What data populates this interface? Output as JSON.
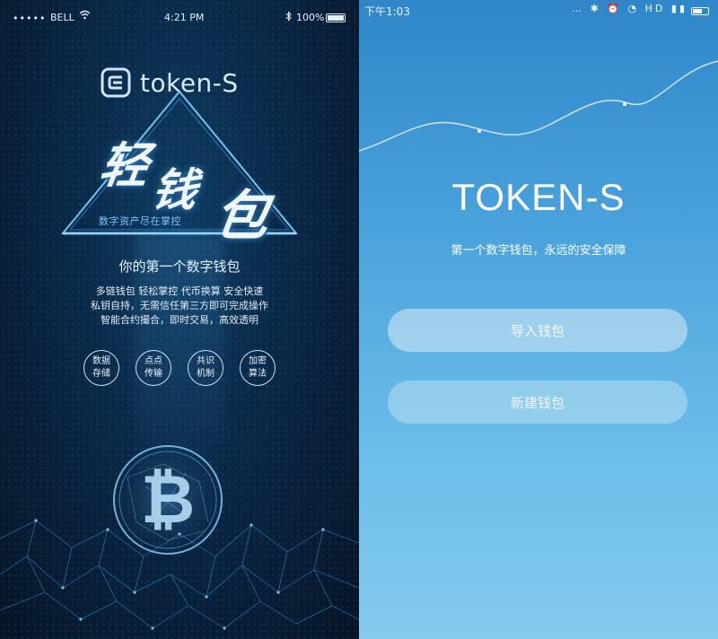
{
  "left_screen": {
    "status_bar": {
      "signal": "•••••",
      "carrier": "BELL",
      "wifi_icon": "wifi-icon",
      "time": "4:21 PM",
      "bluetooth_icon": "bluetooth-icon",
      "battery_percent": "100%"
    },
    "logo_text": "token-S",
    "headline_chars": [
      "轻",
      "钱",
      "包"
    ],
    "slogan": "数字资产尽在掌控",
    "subtitle": "你的第一个数字钱包",
    "description_lines": [
      "多链钱包  轻松掌控  代币换算  安全快速",
      "私钥自持，无需信任第三方即可完成操作",
      "智能合约撮合，即时交易，高效透明"
    ],
    "features": [
      {
        "label": "数据存储"
      },
      {
        "label": "点点传输"
      },
      {
        "label": "共识机制"
      },
      {
        "label": "加密算法"
      }
    ],
    "colors": {
      "accent": "#5ab4ff",
      "background": "#0a2745"
    }
  },
  "right_screen": {
    "status_bar": {
      "time": "下午1:03",
      "icons": "… ✱ ⏰ ◔ HD ▮▮"
    },
    "title": "TOKEN-S",
    "subtitle": "第一个数字钱包，永远的安全保障",
    "buttons": {
      "import_label": "导入钱包",
      "create_label": "新建钱包"
    },
    "colors": {
      "gradient_top": "#2f86c8",
      "gradient_bottom": "#84cbee"
    }
  }
}
